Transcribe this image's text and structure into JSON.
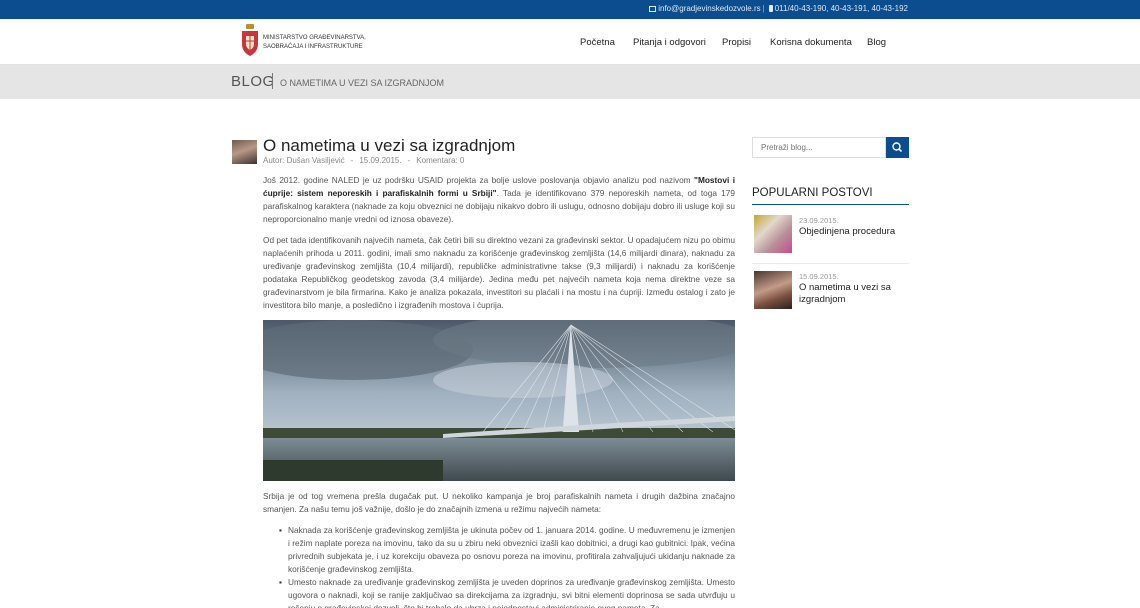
{
  "topbar": {
    "email": "info@gradjevinskedozvole.rs",
    "phone": "011/40-43-190, 40-43-191, 40-43-192",
    "separator": "|"
  },
  "header": {
    "logo_text": "MINISTARSTVO GRAĐEVINARSTVA, SAOBRAĆAJA I INFRASTRUKTURE",
    "nav": [
      "Početna",
      "Pitanja i odgovori",
      "Propisi",
      "Korisna dokumenta",
      "Blog"
    ]
  },
  "breadcrumb": {
    "section": "BLOG",
    "current": "O NAMETIMA U VEZI SA IZGRADNJOM"
  },
  "article": {
    "title": "O nametima u vezi sa izgradnjom",
    "author": "Autor: Dušan Vasiljević",
    "date": "15.09.2015.",
    "comments": "Komentara: 0",
    "meta_separator": "-",
    "p1_before": "Još 2012. godine NALED je uz podršku USAID projekta za bolje uslove poslovanja objavio analizu pod nazivom ",
    "p1_bold": "\"Mostovi i ćuprije: sistem neporeskih i parafiskalnih formi u Srbiji\"",
    "p1_after": ". Tada je identifikovano 379 neporeskih nameta, od toga 179 parafiskalnog karaktera (naknade za koju obveznici ne dobijaju nikakvo dobro ili uslugu, odnosno dobijaju dobro ili usluge koji su neproporcionalno manje vredni od iznosa obaveze).",
    "p2": "Od pet tada identifikovanih najvećih nameta, čak četiri bili su direktno vezani za građevinski sektor. U opadajućem nizu po obimu naplaćenih prihoda u 2011. godini, imali smo naknadu za korišćenje građevinskog zemljišta (14,6 milijardi dinara), naknadu za uređivanje građevinskog zemljišta (10,4 milijardi), republičke administrativne takse (9,3 milijardi) i naknadu za korišćenje podataka Republičkog geodetskog zavoda (3,4 milijarde). Jedina među pet najvećih nameta koja nema direktne veze sa građevinarstvom je bila firmarina. Kako je analiza pokazala, investitori su plaćali i na mostu i na ćupriji. Između ostalog i zato je investitora bilo manje, a posledično i izgrađenih mostova i ćuprija.",
    "p3": "Srbija je od tog vremena prešla dugačak put. U nekoliko kampanja je broj parafiskalnih nameta i drugih dažbina značajno smanjen. Za našu temu još važnije, došlo je do značajnih izmena u režimu najvećih nameta:",
    "bullets": [
      "Naknada za korišćenje građevinskog zemljišta je ukinuta počev od 1. januara 2014. godine. U međuvremenu je izmenjen i režim naplate poreza na imovinu, tako da su u zbiru neki obveznici izašli kao dobitnici, a drugi kao gubitnici. Ipak, većina privrednih subjekata je, i uz korekciju obaveza po osnovu poreza na imovinu, profitirala zahvaljujući ukidanju naknade za korišćenje građevinskog zemljišta.",
      "Umesto naknade za uređivanje građevinskog zemljišta je uveden doprinos za uređivanje građevinskog zemljišta. Umesto ugovora o naknadi, koji se ranije zaključivao sa direkcijama za izgradnju, svi bitni elementi doprinosa se sada utvrđuju u rešenju o građevinskoj dozvoli, što bi trebalo da ubrza i pojednostavi administriranje ovog nameta. Za"
    ]
  },
  "sidebar": {
    "search_placeholder": "Pretraži blog...",
    "popular_title": "POPULARNI POSTOVI",
    "posts": [
      {
        "date": "23.09.2015.",
        "title": "Objedinjena procedura"
      },
      {
        "date": "15.09.2015.",
        "title": "O nametima u vezi sa izgradnjom"
      }
    ]
  },
  "colors": {
    "brand": "#0b4d8f",
    "band": "#e5e5e5"
  }
}
